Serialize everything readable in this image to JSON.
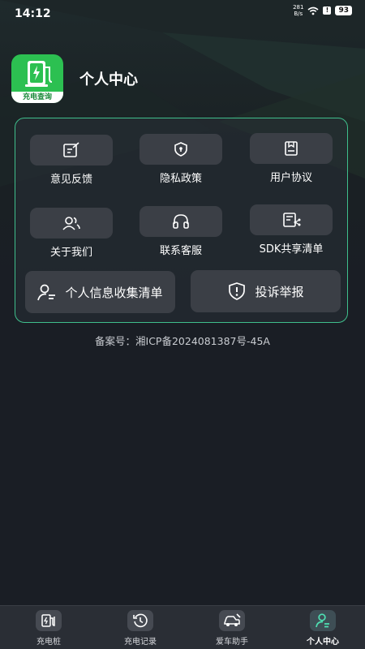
{
  "status_bar": {
    "time": "14:12",
    "net_speed_value": "281",
    "net_speed_unit": "B/s",
    "alert": "!",
    "battery": "93"
  },
  "header": {
    "logo_text": "充电查询",
    "title": "个人中心"
  },
  "menu": {
    "grid": [
      {
        "label": "意见反馈",
        "icon": "feedback-icon"
      },
      {
        "label": "隐私政策",
        "icon": "shield-icon"
      },
      {
        "label": "用户协议",
        "icon": "document-icon"
      },
      {
        "label": "关于我们",
        "icon": "users-icon"
      },
      {
        "label": "联系客服",
        "icon": "headset-icon"
      },
      {
        "label": "SDK共享清单",
        "icon": "list-share-icon"
      }
    ],
    "wide": [
      {
        "label": "个人信息收集清单",
        "icon": "user-info-icon"
      },
      {
        "label": "投诉举报",
        "icon": "warning-shield-icon"
      }
    ]
  },
  "icp": "备案号：湘ICP备2024081387号-45A",
  "bottom_nav": [
    {
      "label": "充电桩",
      "icon": "charging-pile-icon",
      "active": false
    },
    {
      "label": "充电记录",
      "icon": "history-icon",
      "active": false
    },
    {
      "label": "爱车助手",
      "icon": "car-helper-icon",
      "active": false
    },
    {
      "label": "个人中心",
      "icon": "profile-icon",
      "active": true
    }
  ],
  "colors": {
    "accent": "#3fbf8c",
    "logo_green": "#2cc051",
    "background": "#1a1e25",
    "tile": "#3b3f46"
  }
}
